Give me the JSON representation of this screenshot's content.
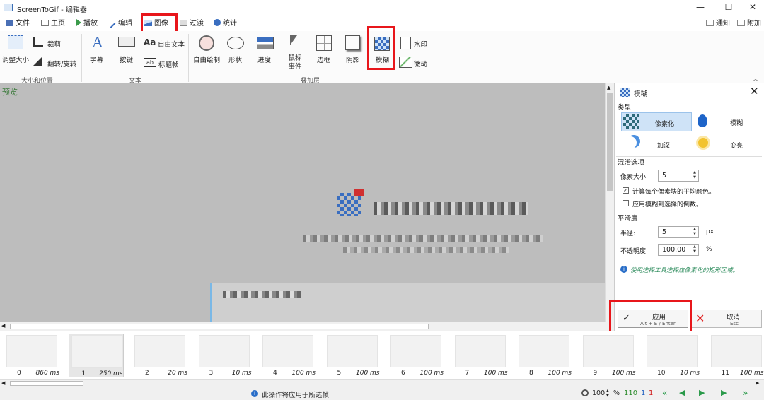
{
  "window": {
    "title": "ScreenToGif - 编辑器",
    "minimize": "—",
    "maximize": "☐",
    "close": "✕"
  },
  "menu": {
    "tabs": [
      "文件",
      "主页",
      "播放",
      "编辑",
      "图像",
      "过渡",
      "统计"
    ],
    "right": [
      "通知",
      "附加"
    ]
  },
  "ribbon": {
    "size_group": {
      "label": "大小和位置",
      "resize": "调整大小",
      "crop": "裁剪",
      "flip_rotate": "翻转/旋转"
    },
    "text_group": {
      "label": "文本",
      "caption": "字幕",
      "key_strokes": "按键",
      "free_text": "自由文本",
      "title_frame": "标题帧"
    },
    "overlay_group": {
      "label": "叠加层",
      "free_drawing": "自由绘制",
      "shapes": "形状",
      "progress": "进度",
      "mouse_events": "鼠标事件",
      "border": "边框",
      "shadow": "阴影",
      "blur": "模糊",
      "watermark": "水印",
      "cinemagraph": "微动"
    }
  },
  "preview": {
    "label": "预览"
  },
  "side_panel": {
    "title": "模糊",
    "type_section": "类型",
    "types": [
      "像素化",
      "模糊",
      "加深",
      "变亮"
    ],
    "selected_type": "像素化",
    "blend_section": "混淆选项",
    "pixel_size_label": "像素大小:",
    "pixel_size_value": "5",
    "use_avg_color": "计算每个像素块的平均颜色。",
    "use_avg_checked": "✓",
    "apply_inverse": "应用模糊到选择的倒数。",
    "smooth_section": "平滑度",
    "radius_label": "半径:",
    "radius_value": "5",
    "radius_unit": "px",
    "opacity_label": "不透明度:",
    "opacity_value": "100.00",
    "opacity_unit": "%",
    "hint": "使用选择工具选择应像素化的矩形区域。",
    "apply": {
      "label": "应用",
      "shortcut": "Alt + E / Enter"
    },
    "cancel": {
      "label": "取消",
      "shortcut": "Esc"
    }
  },
  "frames": [
    {
      "n": "0",
      "ms": "860 ms"
    },
    {
      "n": "1",
      "ms": "250 ms"
    },
    {
      "n": "2",
      "ms": "20 ms"
    },
    {
      "n": "3",
      "ms": "10 ms"
    },
    {
      "n": "4",
      "ms": "100 ms"
    },
    {
      "n": "5",
      "ms": "100 ms"
    },
    {
      "n": "6",
      "ms": "100 ms"
    },
    {
      "n": "7",
      "ms": "100 ms"
    },
    {
      "n": "8",
      "ms": "100 ms"
    },
    {
      "n": "9",
      "ms": "100 ms"
    },
    {
      "n": "10",
      "ms": "10 ms"
    },
    {
      "n": "11",
      "ms": "100 ms"
    }
  ],
  "status": {
    "message": "此操作将应用于所选帧",
    "zoom": "100",
    "zoom_unit": "%",
    "total": "110",
    "selected": "1",
    "current": "1"
  },
  "colors": {
    "accent": "#3a6ec0",
    "highlight": "#e8161b",
    "selected_type_bg": "#cfe3f7",
    "frame_count": "#2a8a2a",
    "selected_count": "#2060c0",
    "current_count": "#d02020"
  }
}
